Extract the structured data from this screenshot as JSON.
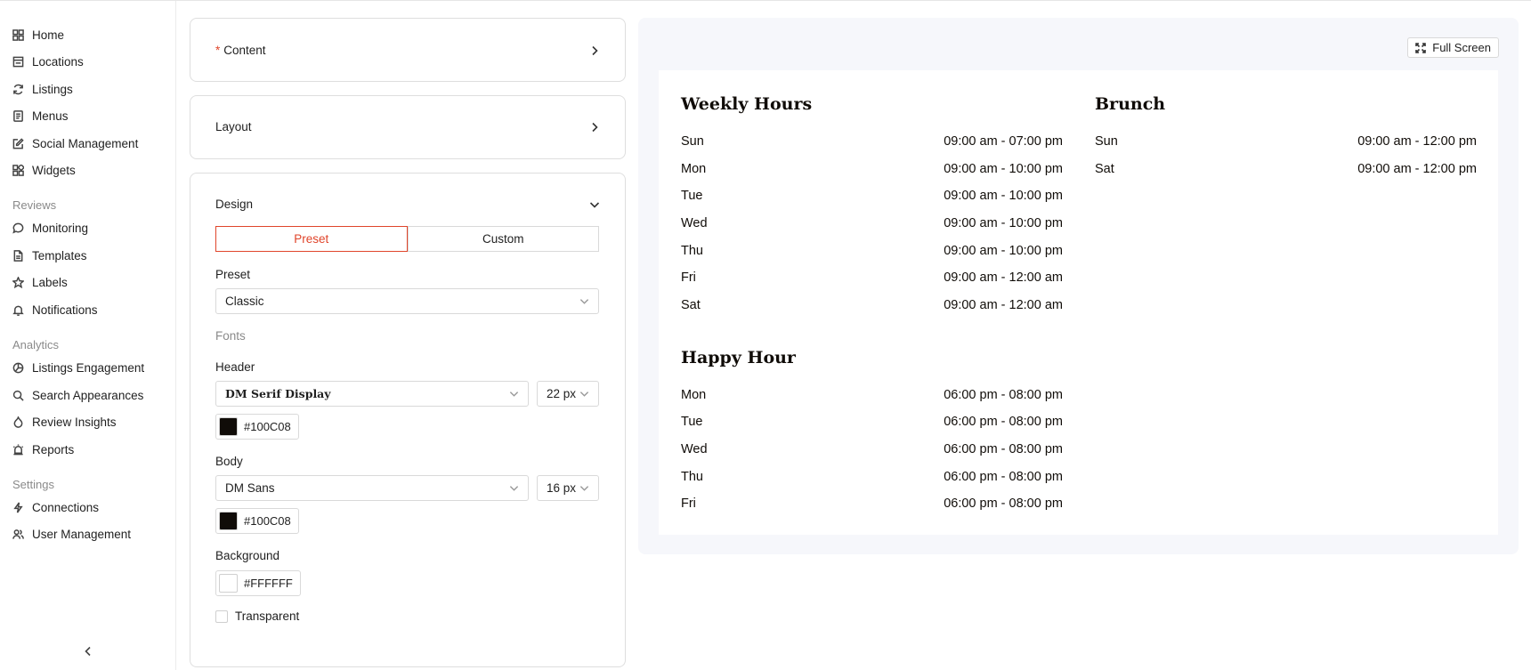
{
  "sidebar": {
    "main_items": [
      {
        "label": "Home",
        "icon": "grid-icon"
      },
      {
        "label": "Locations",
        "icon": "storefront-icon"
      },
      {
        "label": "Listings",
        "icon": "refresh-icon"
      },
      {
        "label": "Menus",
        "icon": "menu-doc-icon"
      },
      {
        "label": "Social Management",
        "icon": "edit-icon"
      },
      {
        "label": "Widgets",
        "icon": "widgets-icon"
      }
    ],
    "reviews_title": "Reviews",
    "reviews_items": [
      {
        "label": "Monitoring",
        "icon": "chat-icon"
      },
      {
        "label": "Templates",
        "icon": "document-icon"
      },
      {
        "label": "Labels",
        "icon": "star-icon"
      },
      {
        "label": "Notifications",
        "icon": "bell-icon"
      }
    ],
    "analytics_title": "Analytics",
    "analytics_items": [
      {
        "label": "Listings Engagement",
        "icon": "pie-chart-icon"
      },
      {
        "label": "Search Appearances",
        "icon": "search-icon"
      },
      {
        "label": "Review Insights",
        "icon": "flame-icon"
      },
      {
        "label": "Reports",
        "icon": "alarm-icon"
      }
    ],
    "settings_title": "Settings",
    "settings_items": [
      {
        "label": "Connections",
        "icon": "bolt-icon"
      },
      {
        "label": "User Management",
        "icon": "users-icon"
      }
    ]
  },
  "panels": {
    "content_required": "*",
    "content_label": "Content",
    "layout_label": "Layout",
    "design_label": "Design"
  },
  "design": {
    "preset_tab": "Preset",
    "custom_tab": "Custom",
    "preset_label": "Preset",
    "preset_value": "Classic",
    "fonts_label": "Fonts",
    "header_label": "Header",
    "header_font": "DM Serif Display",
    "header_size": "22 px",
    "header_color": "#100C08",
    "body_label": "Body",
    "body_font": "DM Sans",
    "body_size": "16 px",
    "body_color": "#100C08",
    "background_label": "Background",
    "background_color": "#FFFFFF",
    "transparent_label": "Transparent"
  },
  "preview": {
    "fullscreen_label": "Full Screen",
    "weekly_title": "Weekly Hours",
    "weekly": [
      {
        "day": "Sun",
        "time": "09:00 am - 07:00 pm"
      },
      {
        "day": "Mon",
        "time": "09:00 am - 10:00 pm"
      },
      {
        "day": "Tue",
        "time": "09:00 am - 10:00 pm"
      },
      {
        "day": "Wed",
        "time": "09:00 am - 10:00 pm"
      },
      {
        "day": "Thu",
        "time": "09:00 am - 10:00 pm"
      },
      {
        "day": "Fri",
        "time": "09:00 am - 12:00 am"
      },
      {
        "day": "Sat",
        "time": "09:00 am - 12:00 am"
      }
    ],
    "brunch_title": "Brunch",
    "brunch": [
      {
        "day": "Sun",
        "time": "09:00 am - 12:00 pm"
      },
      {
        "day": "Sat",
        "time": "09:00 am - 12:00 pm"
      }
    ],
    "happy_title": "Happy Hour",
    "happy": [
      {
        "day": "Mon",
        "time": "06:00 pm - 08:00 pm"
      },
      {
        "day": "Tue",
        "time": "06:00 pm - 08:00 pm"
      },
      {
        "day": "Wed",
        "time": "06:00 pm - 08:00 pm"
      },
      {
        "day": "Thu",
        "time": "06:00 pm - 08:00 pm"
      },
      {
        "day": "Fri",
        "time": "06:00 pm - 08:00 pm"
      }
    ]
  }
}
